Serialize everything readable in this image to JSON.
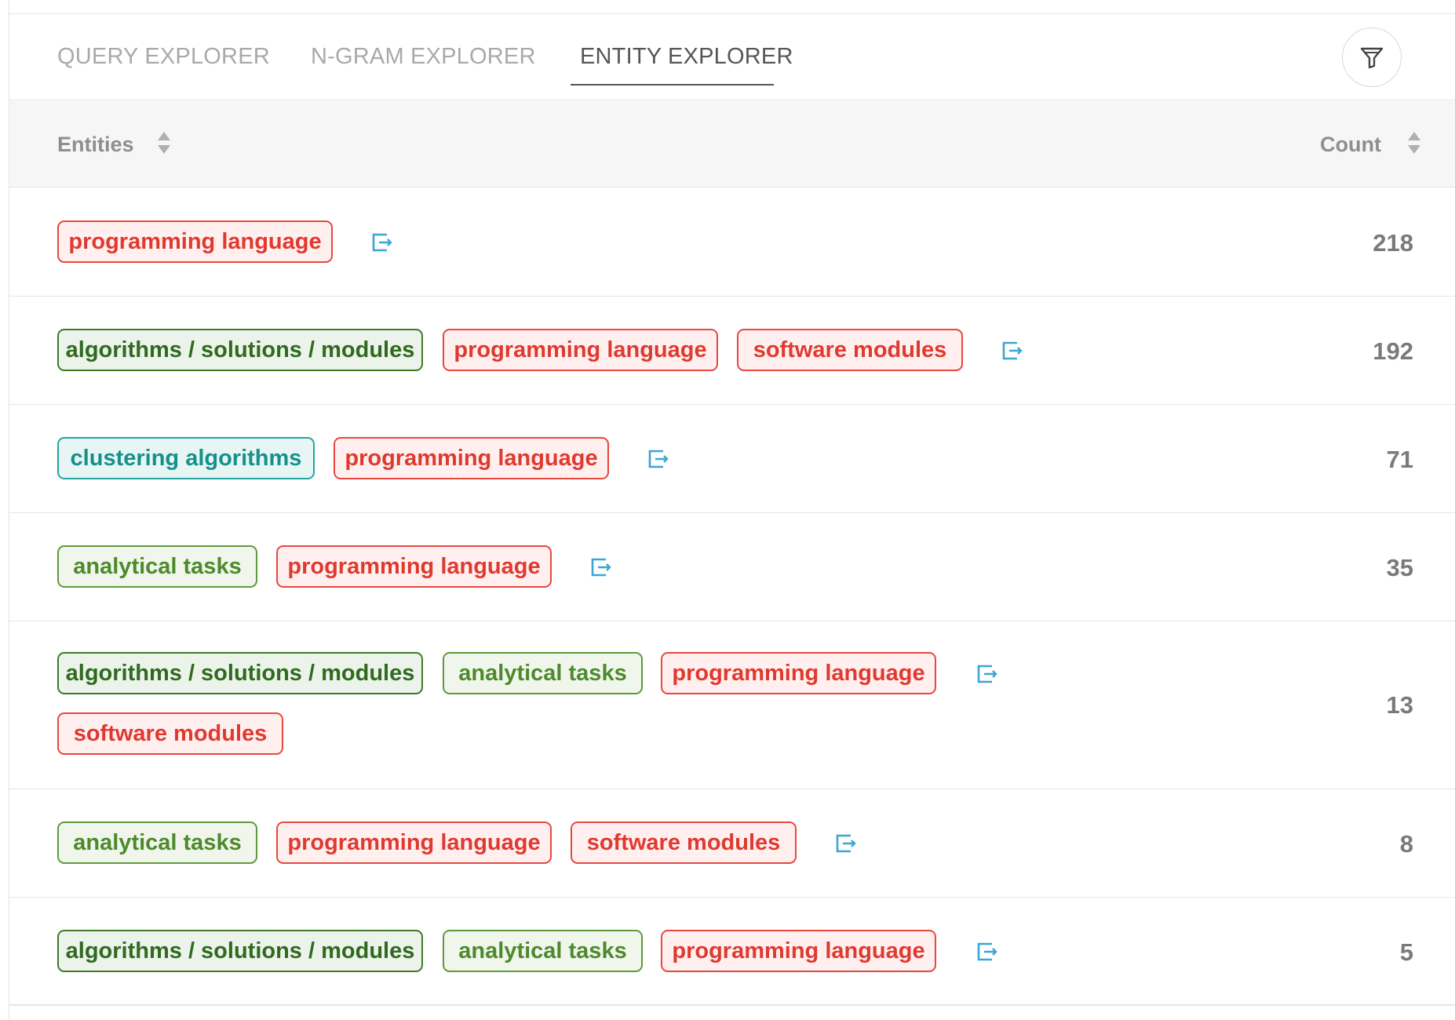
{
  "tabs": [
    {
      "label": "QUERY EXPLORER",
      "active": false
    },
    {
      "label": "N-GRAM EXPLORER",
      "active": false
    },
    {
      "label": "ENTITY EXPLORER",
      "active": true
    }
  ],
  "filter": {
    "icon": "filter-icon"
  },
  "table": {
    "columns": {
      "entities": "Entities",
      "count": "Count"
    },
    "rows": [
      {
        "tags": [
          {
            "label": "programming language",
            "color": "red"
          }
        ],
        "count": "218"
      },
      {
        "tags": [
          {
            "label": "algorithms / solutions / modules",
            "color": "dkgreen"
          },
          {
            "label": "programming language",
            "color": "red"
          },
          {
            "label": "software modules",
            "color": "red"
          }
        ],
        "count": "192"
      },
      {
        "tags": [
          {
            "label": "clustering algorithms",
            "color": "teal"
          },
          {
            "label": "programming language",
            "color": "red"
          }
        ],
        "count": "71"
      },
      {
        "tags": [
          {
            "label": "analytical tasks",
            "color": "green"
          },
          {
            "label": "programming language",
            "color": "red"
          }
        ],
        "count": "35"
      },
      {
        "tags": [
          {
            "label": "algorithms / solutions / modules",
            "color": "dkgreen"
          },
          {
            "label": "analytical tasks",
            "color": "green"
          },
          {
            "label": "programming language",
            "color": "red"
          },
          {
            "label": "software modules",
            "color": "red"
          }
        ],
        "count": "13"
      },
      {
        "tags": [
          {
            "label": "analytical tasks",
            "color": "green"
          },
          {
            "label": "programming language",
            "color": "red"
          },
          {
            "label": "software modules",
            "color": "red"
          }
        ],
        "count": "8"
      },
      {
        "tags": [
          {
            "label": "algorithms / solutions / modules",
            "color": "dkgreen"
          },
          {
            "label": "analytical tasks",
            "color": "green"
          },
          {
            "label": "programming language",
            "color": "red"
          }
        ],
        "count": "5"
      }
    ]
  },
  "colors": {
    "red": "#e0392f",
    "dkgreen": "#2f6a1f",
    "green": "#4c8a2c",
    "teal": "#15918a",
    "open_icon": "#3aa6d6"
  }
}
